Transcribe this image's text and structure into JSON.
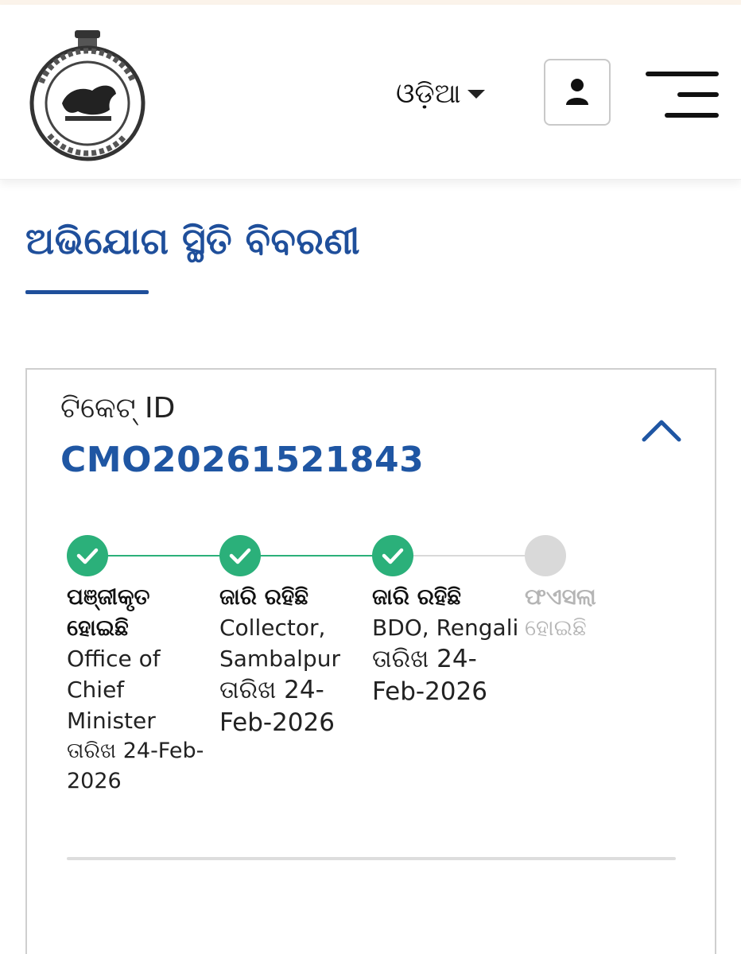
{
  "header": {
    "emblem_name": "odisha-emblem-logo",
    "language_label": "ଓଡ଼ିଆ",
    "user_icon": "user-icon",
    "menu_icon": "hamburger-menu-icon"
  },
  "page": {
    "title": "ଅଭିଯୋଗ ସ୍ଥିତି ବିବରଣୀ"
  },
  "ticket": {
    "label": "ଟିକେଟ୍ ID",
    "id": "CMO20261521843",
    "collapse_icon": "chevron-up-icon"
  },
  "progress": {
    "steps": [
      {
        "status": "done",
        "title": "ପଞ୍ଜୀକୃତ ହୋଇଛି",
        "office": "Office of Chief Minister",
        "date": "ତାରିଖ 24-Feb-2026"
      },
      {
        "status": "done",
        "title": "ଜାରି ରହିଛି",
        "office": "Collector, Sambalpur",
        "date": "ତାରିଖ 24-Feb-2026"
      },
      {
        "status": "done",
        "title": "ଜାରି ରହିଛି",
        "office": "BDO, Rengali",
        "date": "ତାରିଖ 24-Feb-2026"
      },
      {
        "status": "pending",
        "title": "ଫଏସଲା",
        "office": "ହୋଇଛି",
        "date": ""
      }
    ]
  },
  "colors": {
    "primary_blue": "#1f4f9b",
    "ticket_blue": "#1f56a3",
    "done_green": "#2bb07a",
    "pending_grey": "#d9d9d9"
  }
}
